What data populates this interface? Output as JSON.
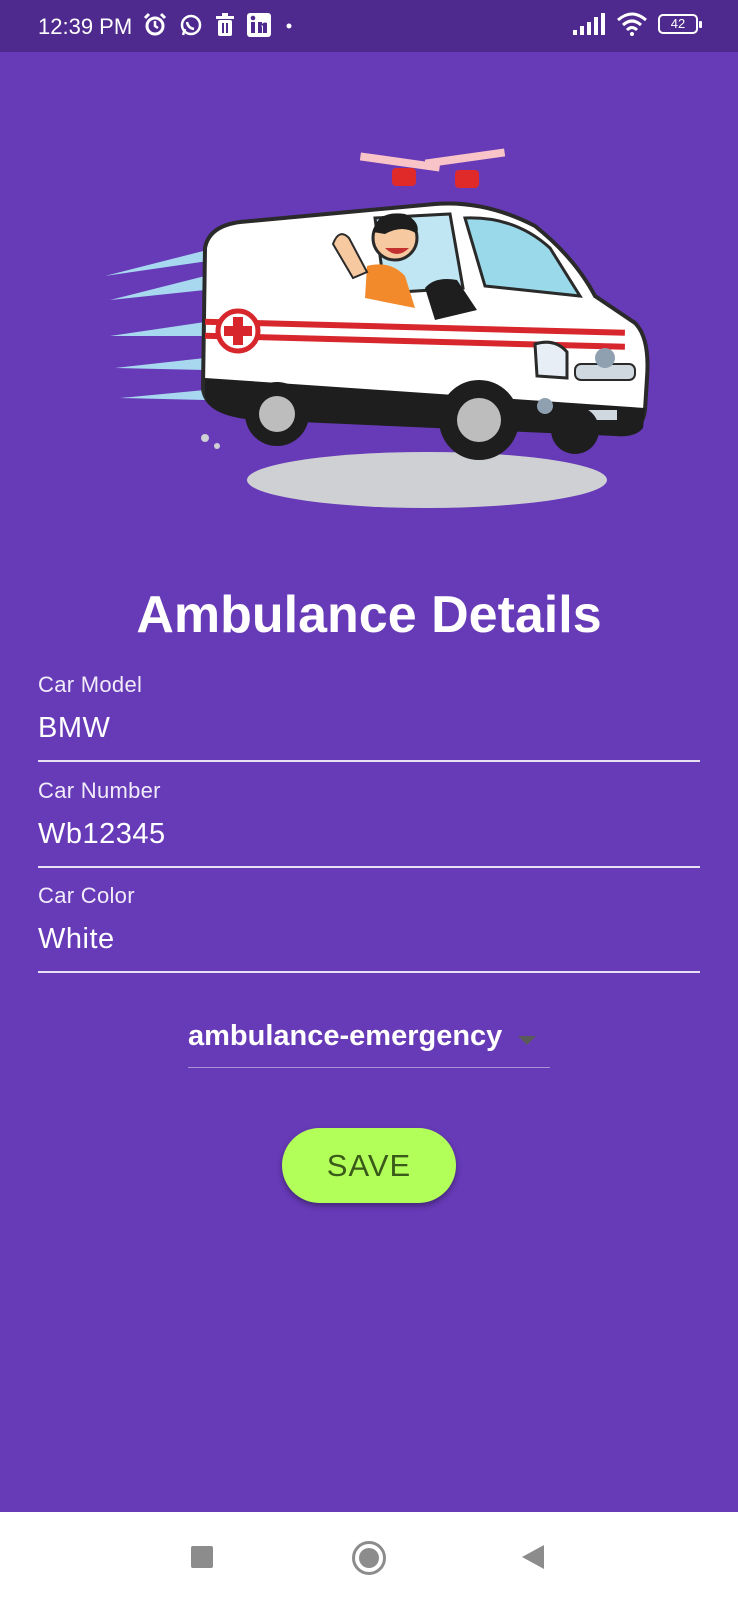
{
  "status_bar": {
    "time": "12:39 PM",
    "battery": "42",
    "left_icons": [
      "alarm-icon",
      "whatsapp-icon",
      "trash-icon",
      "linkedin-icon",
      "dot-icon"
    ],
    "right_icons": [
      "signal-icon",
      "wifi-icon",
      "battery-icon"
    ]
  },
  "header": {
    "title": "Ambulance Details"
  },
  "form": {
    "car_model": {
      "label": "Car Model",
      "value": "BMW"
    },
    "car_number": {
      "label": "Car Number",
      "value": "Wb12345"
    },
    "car_color": {
      "label": "Car Color",
      "value": "White"
    },
    "type_dropdown": {
      "value": "ambulance-emergency"
    },
    "save_label": "SAVE"
  },
  "nav": {
    "icons": [
      "recents-icon",
      "home-icon",
      "back-icon"
    ]
  },
  "colors": {
    "background": "#673ab7",
    "status_bar": "#4f2a8e",
    "accent_button": "#b2ff59",
    "button_text": "#3a5a1a"
  }
}
